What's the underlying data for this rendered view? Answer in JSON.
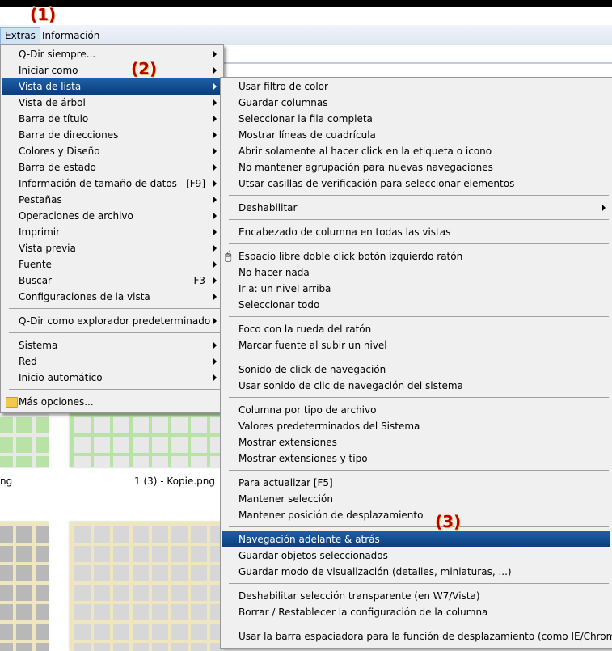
{
  "annotations": [
    "(1)",
    "(2)",
    "(3)"
  ],
  "menubar": {
    "items": [
      "Extras",
      "Información"
    ]
  },
  "files": [
    "ng",
    "1 (3) - Kopie.png"
  ],
  "extras_menu": {
    "items": [
      {
        "label": "Q-Dir siempre...",
        "submenu": true
      },
      {
        "label": "Iniciar como",
        "submenu": true
      },
      {
        "label": "Vista de lista",
        "submenu": true,
        "selected": true
      },
      {
        "label": "Vista de árbol",
        "submenu": true
      },
      {
        "label": "Barra de título",
        "submenu": true
      },
      {
        "label": "Barra de direcciones",
        "submenu": true
      },
      {
        "label": "Colores y Diseño",
        "submenu": true
      },
      {
        "label": "Barra de estado",
        "submenu": true
      },
      {
        "label": "Información de tamaño de datos",
        "shortcut": "[F9]",
        "submenu": true
      },
      {
        "label": "Pestañas",
        "submenu": true
      },
      {
        "label": "Operaciones de archivo",
        "submenu": true
      },
      {
        "label": "Imprimir",
        "submenu": true
      },
      {
        "label": "Vista previa",
        "submenu": true
      },
      {
        "label": "Fuente",
        "submenu": true
      },
      {
        "label": "Buscar",
        "shortcut": "F3",
        "submenu": true
      },
      {
        "label": "Configuraciones de la vista",
        "submenu": true
      },
      {
        "separator": true
      },
      {
        "label": "Q-Dir como explorador predeterminado",
        "submenu": true
      },
      {
        "separator": true
      },
      {
        "label": "Sistema",
        "submenu": true
      },
      {
        "label": "Red",
        "submenu": true
      },
      {
        "label": "Inicio automático",
        "submenu": true
      },
      {
        "separator": true
      },
      {
        "label": "Más opciones...",
        "icon": "folder-icon"
      }
    ]
  },
  "list_view_menu": {
    "items": [
      {
        "label": "Usar filtro de color"
      },
      {
        "label": "Guardar columnas"
      },
      {
        "label": "Seleccionar la fila completa"
      },
      {
        "label": "Mostrar líneas de cuadrícula"
      },
      {
        "label": "Abrir solamente al hacer click en la etiqueta o icono"
      },
      {
        "label": "No mantener agrupación para nuevas navegaciones"
      },
      {
        "label": "Utsar casillas de verificación para seleccionar elementos"
      },
      {
        "separator": true
      },
      {
        "label": "Deshabilitar",
        "submenu": true
      },
      {
        "separator": true
      },
      {
        "label": "Encabezado de columna en todas las vistas"
      },
      {
        "separator": true
      },
      {
        "label": "Espacio libre doble click botón izquierdo ratón",
        "icon": "mouse-icon"
      },
      {
        "label": "No hacer nada"
      },
      {
        "label": "Ir a: un nivel arriba"
      },
      {
        "label": "Seleccionar todo"
      },
      {
        "separator": true
      },
      {
        "label": "Foco con la rueda del ratón"
      },
      {
        "label": "Marcar fuente al subir un nivel"
      },
      {
        "separator": true
      },
      {
        "label": "Sonido de click de navegación"
      },
      {
        "label": "Usar sonido de clic de navegación del sistema"
      },
      {
        "separator": true
      },
      {
        "label": "Columna por tipo de archivo"
      },
      {
        "label": "Valores predeterminados del Sistema"
      },
      {
        "label": "Mostrar extensiones"
      },
      {
        "label": "Mostrar extensiones y tipo"
      },
      {
        "separator": true
      },
      {
        "label": "Para actualizar [F5]"
      },
      {
        "label": "Mantener selección"
      },
      {
        "label": "Mantener posición de desplazamiento"
      },
      {
        "separator": true
      },
      {
        "label": "Navegación adelante & atrás",
        "selected": true
      },
      {
        "label": "Guardar objetos seleccionados"
      },
      {
        "label": "Guardar modo de visualización (detalles, miniaturas, ...)"
      },
      {
        "separator": true
      },
      {
        "label": "Deshabilitar selección transparente (en W7/Vista)"
      },
      {
        "label": "Borrar / Restablecer la configuración de la columna"
      },
      {
        "separator": true
      },
      {
        "label": "Usar la barra espaciadora para la función de desplazamiento (como IE/Chrome)"
      }
    ]
  }
}
